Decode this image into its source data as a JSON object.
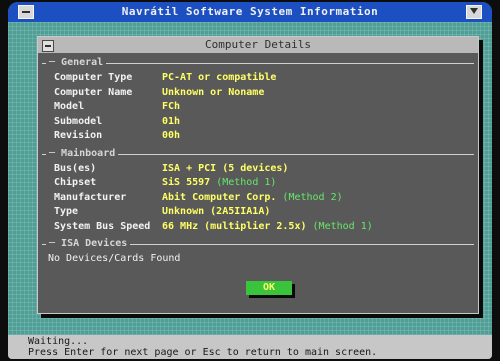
{
  "window": {
    "title": "Navrátil Software System Information",
    "left_icon": "minimize-icon",
    "right_icon": "dropdown-arrow-icon"
  },
  "dialog": {
    "title": "Computer Details",
    "close_icon": "close-icon",
    "sections": {
      "general": {
        "label": "General",
        "rows": [
          {
            "key": "Computer Type",
            "value": "PC-AT or compatible",
            "method": ""
          },
          {
            "key": "Computer Name",
            "value": "Unknown or Noname",
            "method": ""
          },
          {
            "key": "Model",
            "value": "FCh",
            "method": ""
          },
          {
            "key": "Submodel",
            "value": "01h",
            "method": ""
          },
          {
            "key": "Revision",
            "value": "00h",
            "method": ""
          }
        ]
      },
      "mainboard": {
        "label": "Mainboard",
        "rows": [
          {
            "key": "Bus(es)",
            "value": "ISA + PCI (5 devices)",
            "method": ""
          },
          {
            "key": "Chipset",
            "value": "SiS 5597",
            "method": "(Method 1)"
          },
          {
            "key": "Manufacturer",
            "value": "Abit Computer Corp.",
            "method": "(Method 2)"
          },
          {
            "key": "Type",
            "value": "Unknown (2A5IIA1A)",
            "method": ""
          },
          {
            "key": "System Bus Speed",
            "value": "66 MHz (multiplier 2.5x)",
            "method": "(Method 1)"
          }
        ]
      },
      "isa": {
        "label": "ISA Devices",
        "text": "No Devices/Cards Found"
      }
    },
    "ok_label": "OK"
  },
  "status": {
    "line1": "Waiting...",
    "line2": "Press Enter for next page or Esc to return to main screen."
  },
  "colors": {
    "desktop": "#4f9f96",
    "titlebar": "#1c4fc2",
    "dialog_bg": "#595959",
    "value_yellow": "#ffff66",
    "method_green": "#66e86a",
    "ok_green": "#39c43b"
  }
}
